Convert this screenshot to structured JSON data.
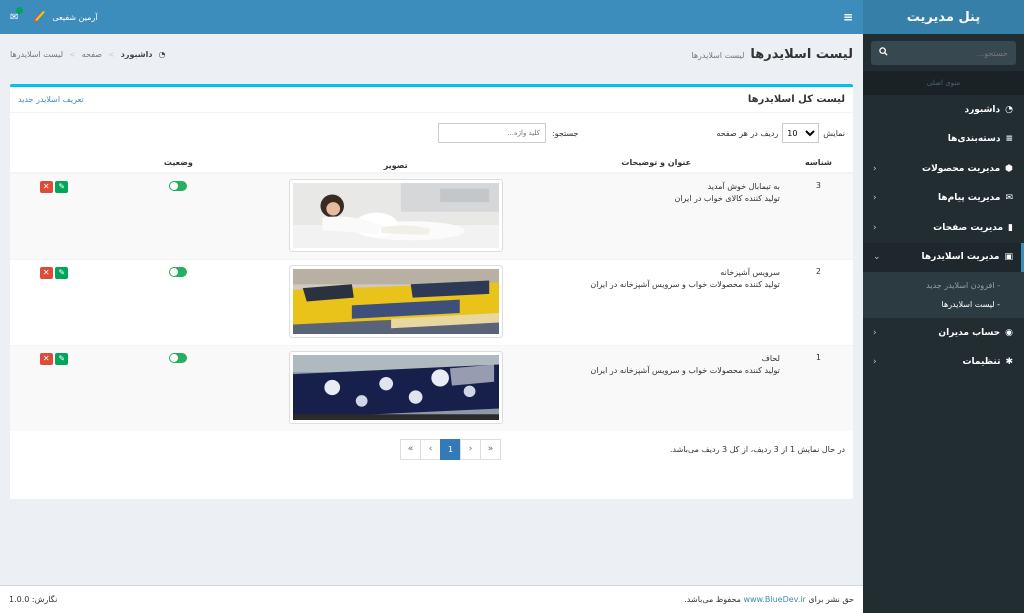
{
  "brand": "پنل مدیریت",
  "sidebar": {
    "search_placeholder": "جستجو...",
    "header": "منوی اصلی",
    "items": [
      {
        "label": "داشبورد",
        "icon": "dashboard-icon",
        "chev": ""
      },
      {
        "label": "دسته‌بندی‌ها",
        "icon": "list-icon",
        "chev": ""
      },
      {
        "label": "مدیریت محصولات",
        "icon": "cubes-icon",
        "chev": "‹"
      },
      {
        "label": "مدیریت پیام‌ها",
        "icon": "envelope-icon",
        "chev": "‹"
      },
      {
        "label": "مدیریت صفحات",
        "icon": "file-icon",
        "chev": "‹"
      },
      {
        "label": "مدیریت اسلایدرها",
        "icon": "image-icon",
        "chev": "⌄"
      }
    ],
    "subitems": [
      "افزودن اسلایدر جدید",
      "لیست اسلایدرها"
    ],
    "items2": [
      {
        "label": "حساب مدیران",
        "icon": "user-circle-icon",
        "chev": "‹"
      },
      {
        "label": "تنظیمات",
        "icon": "gear-icon",
        "chev": "‹"
      }
    ]
  },
  "topbar": {
    "user_name": "آرمین شفیعی",
    "menu_icon": "≡"
  },
  "page": {
    "title": "لیست اسلایدرها",
    "subtitle": "لیست اسلایدرها"
  },
  "breadcrumb": {
    "home": "داشبورد",
    "page": "صفحه",
    "current": "لیست اسلایدرها"
  },
  "box": {
    "title": "لیست کل اسلایدرها",
    "new_link": "تعریف اسلایدر جدید"
  },
  "controls": {
    "show_label": "نمایش",
    "length_value": "10",
    "per_page_label": "ردیف در هر صفحه",
    "search_label": "جستجو:",
    "search_placeholder": "کلید واژه..."
  },
  "table": {
    "headers": {
      "id": "شناسه",
      "title": "عنوان و توضیحات",
      "image": "تصویر",
      "status": "وضعیت"
    },
    "rows": [
      {
        "id": "3",
        "title": "به تیمابال خوش آمدید",
        "desc": "تولید کننده کالای خواب در ایران"
      },
      {
        "id": "2",
        "title": "سرویس آشپزخانه",
        "desc": "تولید کننده محصولات خواب و سرویس آشپزخانه در ایران"
      },
      {
        "id": "1",
        "title": "لحاف",
        "desc": "تولید کننده محصولات خواب و سرویس آشپزخانه در ایران"
      }
    ]
  },
  "info_text": "در حال نمایش 1 از 3 ردیف، از کل 3 ردیف می‌باشد.",
  "pager": {
    "first": "«",
    "prev": "‹",
    "current": "1",
    "next": "›",
    "last": "»"
  },
  "footer": {
    "copyright_pre": "حق نشر برای",
    "copyright_link": "www.BlueDev.ir",
    "copyright_post": "محفوظ می‌باشد.",
    "version": "نگارش: 1.0.0"
  }
}
